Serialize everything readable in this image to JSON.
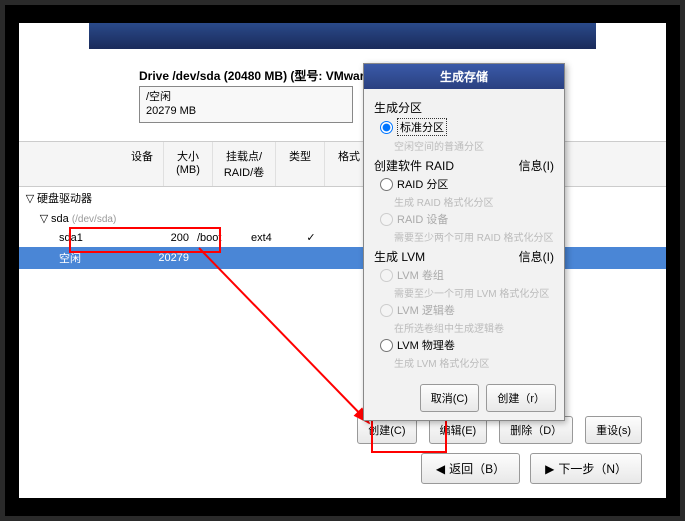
{
  "drive": {
    "title": "Drive /dev/sda (20480 MB) (型号: VMwar",
    "free_label": "/空闲",
    "free_size": "20279 MB"
  },
  "headers": {
    "device": "设备",
    "size": "大小\n(MB)",
    "mount": "挂载点/\nRAID/卷",
    "type": "类型",
    "format": "格式"
  },
  "rows": {
    "hdd_group": "硬盘驱动器",
    "sda": "sda",
    "sda_hint": "(/dev/sda)",
    "sda1": {
      "name": "sda1",
      "size": "200",
      "mount": "/boot",
      "type": "ext4",
      "fmt": "✓"
    },
    "free": {
      "name": "空闲",
      "size": "20279"
    }
  },
  "dialog": {
    "title": "生成存储",
    "sect_partition": "生成分区",
    "info": "信息(I)",
    "opt_standard": "标准分区",
    "hint_standard": "空闲空间的普通分区",
    "sect_raid": "创建软件 RAID",
    "opt_raid_part": "RAID 分区",
    "hint_raid_part": "生成 RAID 格式化分区",
    "opt_raid_dev": "RAID 设备",
    "hint_raid_dev": "需要至少两个可用 RAID 格式化分区",
    "sect_lvm": "生成 LVM",
    "opt_lvm_vg": "LVM 卷组",
    "hint_lvm_vg": "需要至少一个可用 LVM 格式化分区",
    "opt_lvm_lv": "LVM 逻辑卷",
    "hint_lvm_lv": "在所选卷组中生成逻辑卷",
    "opt_lvm_pv": "LVM 物理卷",
    "hint_lvm_pv": "生成 LVM 格式化分区",
    "cancel": "取消(C)",
    "create": "创建（r）"
  },
  "bottom": {
    "create": "创建(C)",
    "edit": "编辑(E)",
    "delete": "删除（D）",
    "reset": "重设(s)"
  },
  "nav": {
    "back": "返回（B）",
    "next": "下一步（N）"
  }
}
